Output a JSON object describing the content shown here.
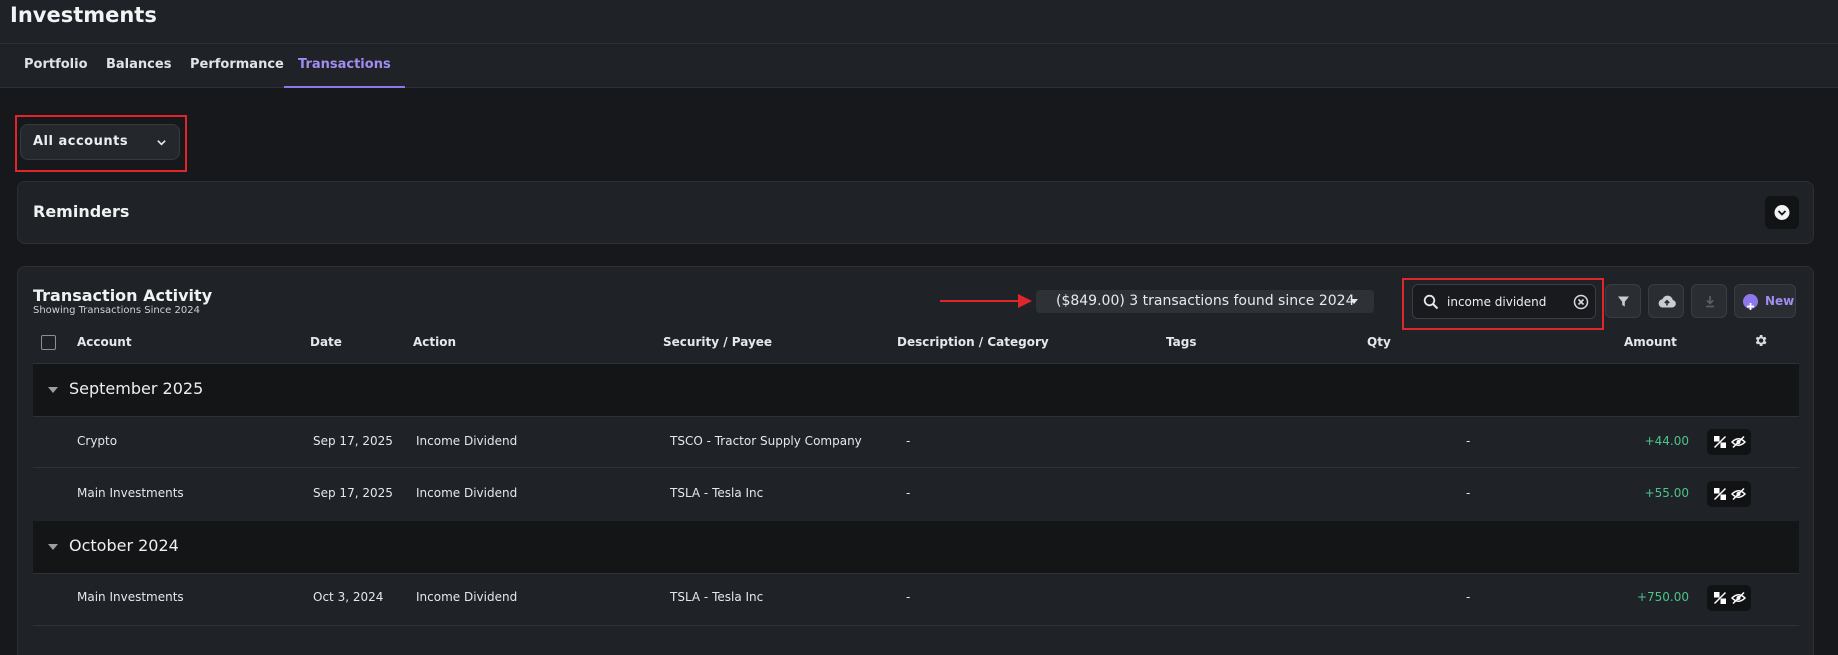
{
  "header": {
    "title": "Investments"
  },
  "tabs": [
    {
      "label": "Portfolio",
      "active": false
    },
    {
      "label": "Balances",
      "active": false
    },
    {
      "label": "Performance",
      "active": false
    },
    {
      "label": "Transactions",
      "active": true
    }
  ],
  "account_filter": {
    "selected": "All accounts"
  },
  "reminders": {
    "title": "Reminders"
  },
  "activity": {
    "title": "Transaction Activity",
    "subtitle": "Showing Transactions Since 2024",
    "summary": "($849.00) 3 transactions found since 2024",
    "search_value": "income dividend",
    "new_label": "New",
    "columns": {
      "account": "Account",
      "date": "Date",
      "action": "Action",
      "security": "Security / Payee",
      "description": "Description / Category",
      "tags": "Tags",
      "qty": "Qty",
      "amount": "Amount"
    },
    "groups": [
      {
        "label": "September 2025",
        "rows": [
          {
            "account": "Crypto",
            "date": "Sep 17, 2025",
            "action": "Income Dividend",
            "security": "TSCO - Tractor Supply Company",
            "description": "-",
            "qty": "-",
            "amount": "+44.00"
          },
          {
            "account": "Main Investments",
            "date": "Sep 17, 2025",
            "action": "Income Dividend",
            "security": "TSLA - Tesla Inc",
            "description": "-",
            "qty": "-",
            "amount": "+55.00"
          }
        ]
      },
      {
        "label": "October 2024",
        "rows": [
          {
            "account": "Main Investments",
            "date": "Oct 3, 2024",
            "action": "Income Dividend",
            "security": "TSLA - Tesla Inc",
            "description": "-",
            "qty": "-",
            "amount": "+750.00"
          }
        ]
      }
    ]
  },
  "colors": {
    "accent": "#8e76ec",
    "positive": "#4cc38a",
    "highlight": "#e0262b"
  },
  "icons": [
    "chevron-down-icon",
    "search-icon",
    "clear-icon",
    "filter-icon",
    "cloud-upload-icon",
    "download-icon",
    "plus-circle-icon",
    "gear-icon",
    "collapse-caret-icon",
    "split-icon",
    "hide-icon"
  ]
}
